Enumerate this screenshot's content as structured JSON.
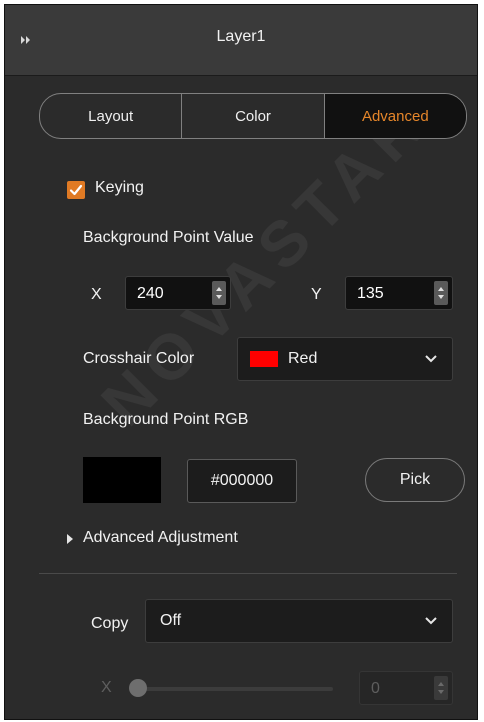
{
  "panel": {
    "title": "Layer1"
  },
  "tabs": [
    {
      "label": "Layout"
    },
    {
      "label": "Color"
    },
    {
      "label": "Advanced",
      "active": true
    }
  ],
  "keying": {
    "label": "Keying",
    "checked": true
  },
  "background_point": {
    "section_label": "Background Point Value",
    "x_label": "X",
    "x_value": "240",
    "y_label": "Y",
    "y_value": "135"
  },
  "crosshair": {
    "label": "Crosshair Color",
    "selected": "Red",
    "swatch_color": "#ff0000"
  },
  "background_rgb": {
    "section_label": "Background Point RGB",
    "hex_value": "#000000",
    "preview_color": "#000000",
    "pick_label": "Pick"
  },
  "advanced_adjustment": {
    "label": "Advanced Adjustment",
    "expanded": false
  },
  "copy": {
    "label": "Copy",
    "selected": "Off"
  },
  "copy_x": {
    "label": "X",
    "value": "0",
    "slider_level": 0,
    "disabled": true
  },
  "watermark": {
    "text": "NOVASTAR"
  },
  "colors": {
    "accent": "#e6862a",
    "panel_bg": "#2b2b2b",
    "header_bg": "#3a3a3a"
  }
}
